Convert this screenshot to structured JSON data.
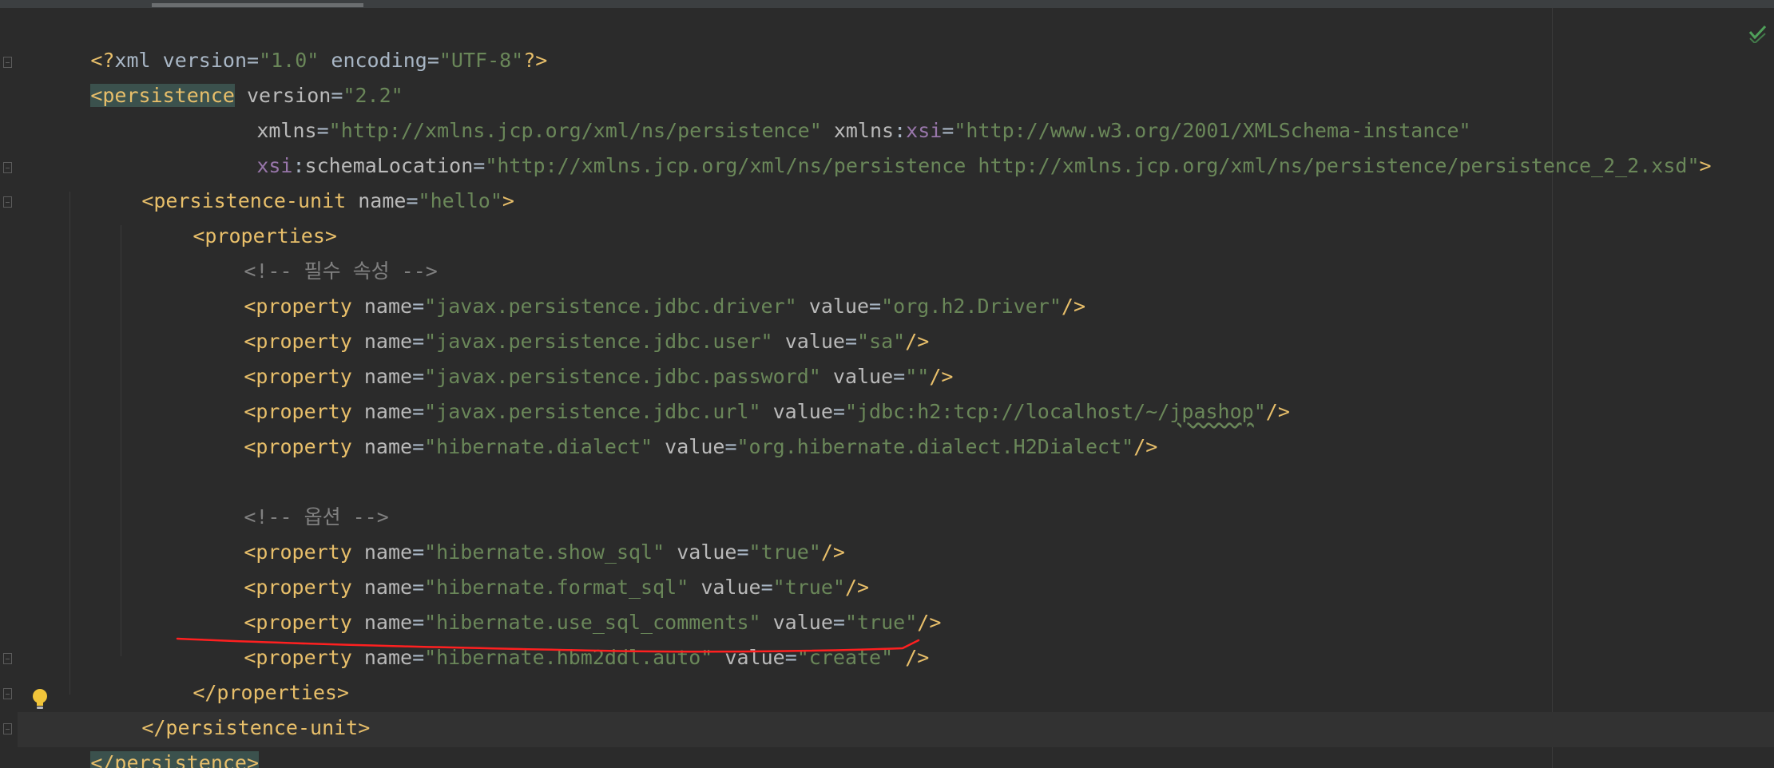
{
  "editor": {
    "language": "xml",
    "colors": {
      "background": "#2b2b2b",
      "tag": "#e8bf6a",
      "attribute": "#bababa",
      "namespace_prefix": "#9876aa",
      "string": "#6a8759",
      "comment": "#808080",
      "text": "#a9b7c6",
      "tag_match_highlight": "#3b514d",
      "annotation": "#ff2020"
    },
    "icons": {
      "bulb": "lightbulb-icon",
      "inspection_ok": "checkmark-icon",
      "fold": "fold-marker-icon"
    }
  },
  "lines": {
    "l1": {
      "open": "<?",
      "target": "xml",
      "a1": "version",
      "v1": "\"1.0\"",
      "a2": "encoding",
      "v2": "\"UTF-8\"",
      "close": "?>"
    },
    "l2": {
      "tag": "<persistence",
      "a1": "version",
      "v1": "\"2.2\""
    },
    "l3": {
      "a1": "xmlns",
      "v1": "\"http://xmlns.jcp.org/xml/ns/persistence\"",
      "a2_prefix": "xmlns",
      "a2_ns": "xsi",
      "v2": "\"http://www.w3.org/2001/XMLSchema-instance\""
    },
    "l4": {
      "ns": "xsi",
      "a1": "schemaLocation",
      "v1": "\"http://xmlns.jcp.org/xml/ns/persistence http://xmlns.jcp.org/xml/ns/persistence/persistence_2_2.xsd\"",
      "close": ">"
    },
    "l5": {
      "tag": "<persistence-unit",
      "a1": "name",
      "v1": "\"hello\"",
      "close": ">"
    },
    "l6": {
      "tag": "<properties>"
    },
    "l7": {
      "comment": "<!-- 필수 속성 -->"
    },
    "l8": {
      "tag": "<property",
      "a1": "name",
      "v1": "\"javax.persistence.jdbc.driver\"",
      "a2": "value",
      "v2": "\"org.h2.Driver\"",
      "close": "/>"
    },
    "l9": {
      "tag": "<property",
      "a1": "name",
      "v1": "\"javax.persistence.jdbc.user\"",
      "a2": "value",
      "v2": "\"sa\"",
      "close": "/>"
    },
    "l10": {
      "tag": "<property",
      "a1": "name",
      "v1": "\"javax.persistence.jdbc.password\"",
      "a2": "value",
      "v2": "\"\"",
      "close": "/>"
    },
    "l11": {
      "tag": "<property",
      "a1": "name",
      "v1": "\"javax.persistence.jdbc.url\"",
      "a2": "value",
      "v2a": "\"jdbc:h2:tcp://localhost/~/",
      "v2b": "jpashop",
      "v2c": "\"",
      "close": "/>"
    },
    "l12": {
      "tag": "<property",
      "a1": "name",
      "v1": "\"hibernate.dialect\"",
      "a2": "value",
      "v2": "\"org.hibernate.dialect.H2Dialect\"",
      "close": "/>"
    },
    "l14": {
      "comment": "<!-- 옵션 -->"
    },
    "l15": {
      "tag": "<property",
      "a1": "name",
      "v1": "\"hibernate.show_sql\"",
      "a2": "value",
      "v2": "\"true\"",
      "close": "/>"
    },
    "l16": {
      "tag": "<property",
      "a1": "name",
      "v1": "\"hibernate.format_sql\"",
      "a2": "value",
      "v2": "\"true\"",
      "close": "/>"
    },
    "l17": {
      "tag": "<property",
      "a1": "name",
      "v1": "\"hibernate.use_sql_comments\"",
      "a2": "value",
      "v2": "\"true\"",
      "close": "/>"
    },
    "l18": {
      "tag": "<property",
      "a1": "name",
      "v1": "\"hibernate.hbm2ddl.auto\"",
      "a2": "value",
      "v2": "\"create\"",
      "close": "/>"
    },
    "l19": {
      "tag": "</properties>"
    },
    "l20": {
      "tag": "</persistence-unit>"
    },
    "l21": {
      "tag": "</persistence>"
    }
  }
}
